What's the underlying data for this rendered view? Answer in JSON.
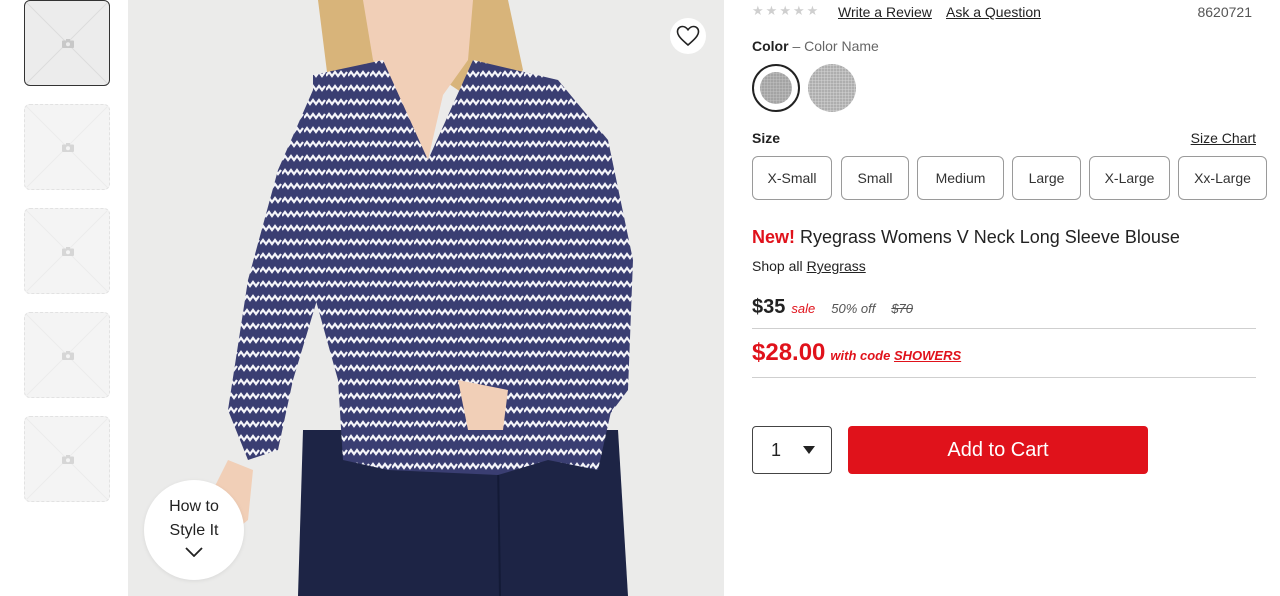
{
  "thumbnails": [
    {
      "state": "active"
    },
    {
      "state": "placeholder"
    },
    {
      "state": "placeholder"
    },
    {
      "state": "placeholder"
    },
    {
      "state": "placeholder"
    }
  ],
  "hero": {
    "favorite_icon": "heart-outline-icon",
    "style_it_label": "How to Style It",
    "style_it_icon": "chevron-down-icon"
  },
  "rating": {
    "stars_filled": 0,
    "stars_total": 5,
    "write_review": "Write a Review",
    "ask_question": "Ask a Question"
  },
  "sku": "8620721",
  "color": {
    "label": "Color",
    "separator": "–",
    "name": "Color Name",
    "swatches": [
      "selected",
      "alternate"
    ]
  },
  "size": {
    "label": "Size",
    "chart_link": "Size Chart",
    "options": [
      "X-Small",
      "Small",
      "Medium",
      "Large",
      "X-Large",
      "Xx-Large"
    ]
  },
  "product": {
    "badge": "New!",
    "title": "Ryegrass Womens V Neck Long Sleeve Blouse",
    "shop_all_prefix": "Shop all",
    "brand": "Ryegrass"
  },
  "pricing": {
    "price": "$35",
    "sale_label": "sale",
    "discount": "50% off",
    "original": "$70",
    "code_price": "$28.00",
    "code_prefix": "with code",
    "code": "SHOWERS"
  },
  "cart": {
    "quantity": "1",
    "add_label": "Add to Cart"
  },
  "colors": {
    "accent_red": "#e0121b",
    "text": "#222222"
  }
}
